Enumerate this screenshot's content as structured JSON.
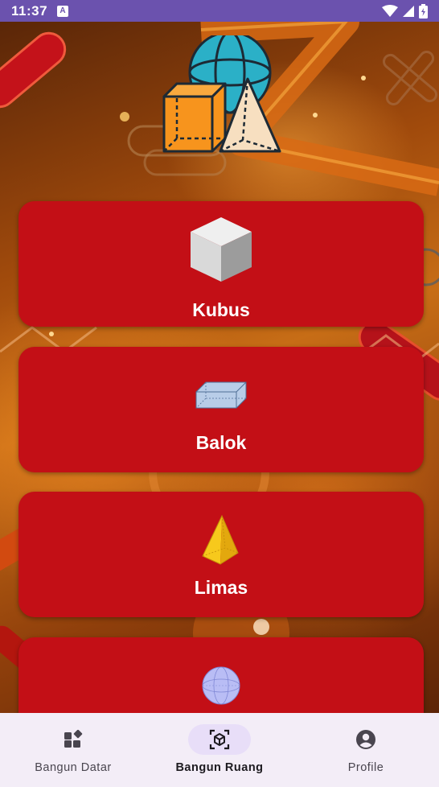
{
  "status_bar": {
    "time": "11:37",
    "notification_icon": "A"
  },
  "cards": [
    {
      "label": "Kubus",
      "icon": "cube-icon"
    },
    {
      "label": "Balok",
      "icon": "cuboid-icon"
    },
    {
      "label": "Limas",
      "icon": "pyramid-icon"
    },
    {
      "label": "",
      "icon": "sphere-icon"
    }
  ],
  "bottom_nav": {
    "items": [
      {
        "label": "Bangun Datar",
        "icon": "dashboard-icon",
        "active": false
      },
      {
        "label": "Bangun Ruang",
        "icon": "cube-outline-icon",
        "active": true
      },
      {
        "label": "Profile",
        "icon": "account-circle-icon",
        "active": false
      }
    ]
  },
  "colors": {
    "status_bar": "#6b52ae",
    "card": "#c30f16",
    "nav_background": "#f3edf7",
    "nav_active_pill": "#e8def8"
  }
}
